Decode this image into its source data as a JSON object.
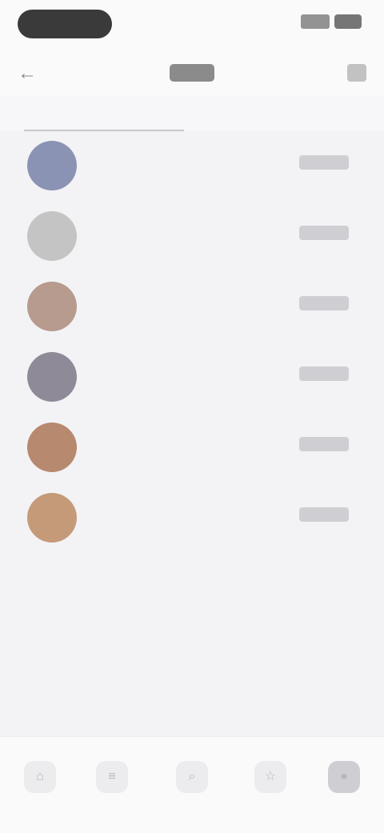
{
  "header": {
    "back_icon": "←",
    "title": "",
    "action_icon": "⋯"
  },
  "tabs": [
    {
      "label": ""
    },
    {
      "label": ""
    }
  ],
  "rows": [
    {
      "line1": "",
      "line2": "",
      "avatar_color": "#8b93b5"
    },
    {
      "line1": "",
      "line2": "",
      "avatar_color": "#c4c4c4"
    },
    {
      "line1": "",
      "line2": "",
      "avatar_color": "#b79b8f"
    },
    {
      "line1": "",
      "line2": "",
      "avatar_color": "#8e8a98"
    },
    {
      "line1": "",
      "line2": "",
      "avatar_color": "#b7896f"
    },
    {
      "line1": "",
      "line2": "",
      "avatar_color": "#c59a79"
    }
  ],
  "info": {
    "title": "",
    "body": ""
  },
  "tabbar_icons": [
    "home-icon",
    "list-icon",
    "search-icon",
    "star-icon",
    "profile-icon"
  ]
}
